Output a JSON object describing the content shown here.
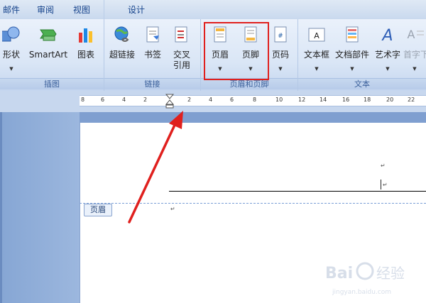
{
  "tabs": [
    "邮件",
    "审阅",
    "视图",
    "设计"
  ],
  "ribbon": {
    "insert_illustrations": {
      "label": "插图",
      "buttons": [
        "形状",
        "SmartArt",
        "图表"
      ]
    },
    "links": {
      "label": "链接",
      "buttons": [
        "超链接",
        "书签",
        "交叉引用"
      ]
    },
    "header_footer": {
      "label": "页眉和页脚",
      "buttons": [
        "页眉",
        "页脚",
        "页码"
      ]
    },
    "text": {
      "label": "文本",
      "buttons": [
        "文本框",
        "文档部件",
        "艺术字",
        "首字下"
      ]
    }
  },
  "ruler": {
    "ticks": [
      "8",
      "6",
      "4",
      "2",
      "2",
      "4",
      "6",
      "8",
      "10",
      "12",
      "14",
      "16",
      "18",
      "20",
      "22"
    ]
  },
  "document": {
    "header_tag": "页眉",
    "paragraph_mark": "↵"
  },
  "watermark": {
    "brand": "Baidu经验",
    "url": "jingyan.baidu.com"
  },
  "colors": {
    "highlight": "#e0201e",
    "arrow": "#e0201e"
  }
}
